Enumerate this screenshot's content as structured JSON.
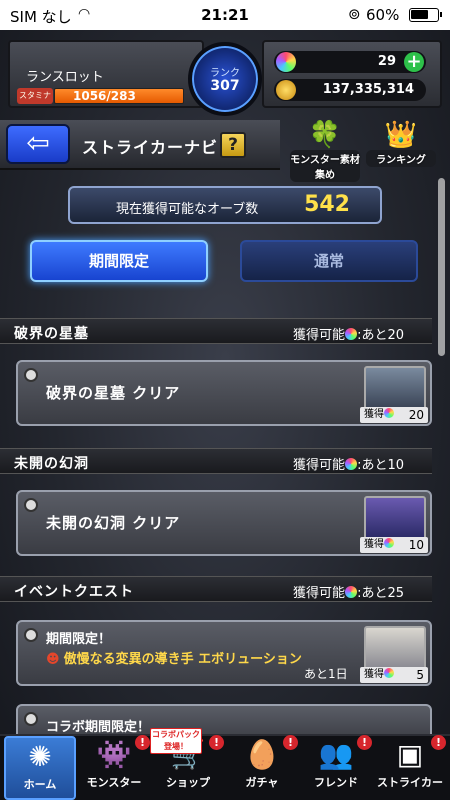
{
  "status_bar": {
    "carrier": "SIM なし",
    "time": "21:21",
    "battery": "60%"
  },
  "player": {
    "name": "ランスロット",
    "stamina_label": "スタミナ",
    "stamina": "1056/283",
    "rank_label": "ランク",
    "rank": "307"
  },
  "currency": {
    "orbs": "29",
    "coins": "137,335,314"
  },
  "nav": {
    "title": "ストライカーナビ",
    "help": "?",
    "monster_collection": "モンスター素材集め",
    "ranking": "ランキング"
  },
  "orb_counter": {
    "label": "現在獲得可能なオーブ数",
    "value": "542"
  },
  "tabs": [
    {
      "label": "期間限定"
    },
    {
      "label": "通常"
    }
  ],
  "sections": [
    {
      "title": "破界の星墓",
      "avail": "獲得可能",
      "remaining": ":あと20",
      "quest": {
        "title": "破界の星墓 クリア",
        "reward_label": "獲得",
        "reward": "20"
      }
    },
    {
      "title": "未開の幻洞",
      "avail": "獲得可能",
      "remaining": ":あと10",
      "quest": {
        "title": "未開の幻洞 クリア",
        "reward_label": "獲得",
        "reward": "10"
      }
    },
    {
      "title": "イベントクエスト",
      "avail": "獲得可能",
      "remaining": ":あと25",
      "quest": {
        "line1": "期間限定！",
        "line2": "傲慢なる変異の導き手 エボリューション",
        "remain": "あと1日",
        "reward_label": "獲得",
        "reward": "5"
      }
    }
  ],
  "collab": {
    "line1": "コラボ期間限定！"
  },
  "bottom_nav": {
    "home": "ホーム",
    "monster": "モンスター",
    "shop": "ショップ",
    "gacha": "ガチャ",
    "friend": "フレンド",
    "striker": "ストライカー",
    "collab_tag": "コラボパック登場！",
    "badge": "!"
  },
  "colors": {
    "accent_blue": "#3f7bff",
    "orb_gold": "#ffe14a",
    "stamina_orange": "#ff8a2a",
    "badge_red": "#d7262d"
  }
}
